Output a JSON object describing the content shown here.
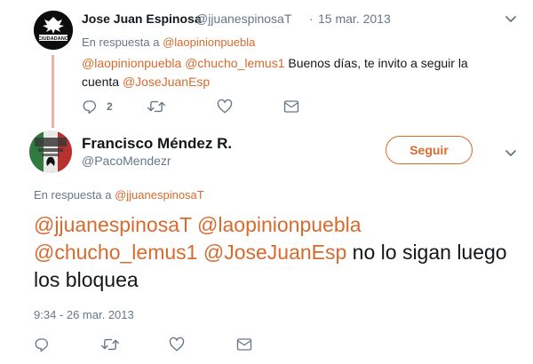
{
  "parent_tweet": {
    "display_name": "Jose Juan Espinosa",
    "handle": "@jjuanespinosaT",
    "dot": "·",
    "date": "15 mar. 2013",
    "reply_prefix": "En respuesta a",
    "reply_to": "@laopinionpuebla",
    "text_parts": [
      {
        "text": "@laopinionpuebla",
        "mention": true
      },
      {
        "text": " ",
        "mention": false
      },
      {
        "text": "@chucho_lemus1",
        "mention": true
      },
      {
        "text": " Buenos días, te invito a seguir la cuenta ",
        "mention": false
      },
      {
        "text": "@JoseJuanEsp",
        "mention": true
      }
    ],
    "reply_count": "2",
    "avatar_text": "CIUDADANO"
  },
  "main_tweet": {
    "display_name": "Francisco Méndez R.",
    "handle": "@PacoMendezr",
    "follow_label": "Seguir",
    "reply_prefix": "En respuesta a",
    "reply_to": "@jjuanespinosaT",
    "text_parts": [
      {
        "text": "@jjuanespinosaT",
        "mention": true
      },
      {
        "text": " ",
        "mention": false
      },
      {
        "text": "@laopinionpuebla",
        "mention": true
      },
      {
        "text": " ",
        "mention": false
      },
      {
        "text": "@chucho_lemus1",
        "mention": true
      },
      {
        "text": " ",
        "mention": false
      },
      {
        "text": "@JoseJuanEsp",
        "mention": true
      },
      {
        "text": " no lo sigan luego los bloquea",
        "mention": false
      }
    ],
    "timestamp": "9:34 - 26 mar. 2013"
  },
  "colors": {
    "link": "#d86a2d",
    "thread_line": "#e8b3a2",
    "muted": "#657786",
    "text": "#14171a"
  },
  "icons": [
    "reply-icon",
    "retweet-icon",
    "like-icon",
    "message-icon",
    "chevron-down-icon"
  ]
}
